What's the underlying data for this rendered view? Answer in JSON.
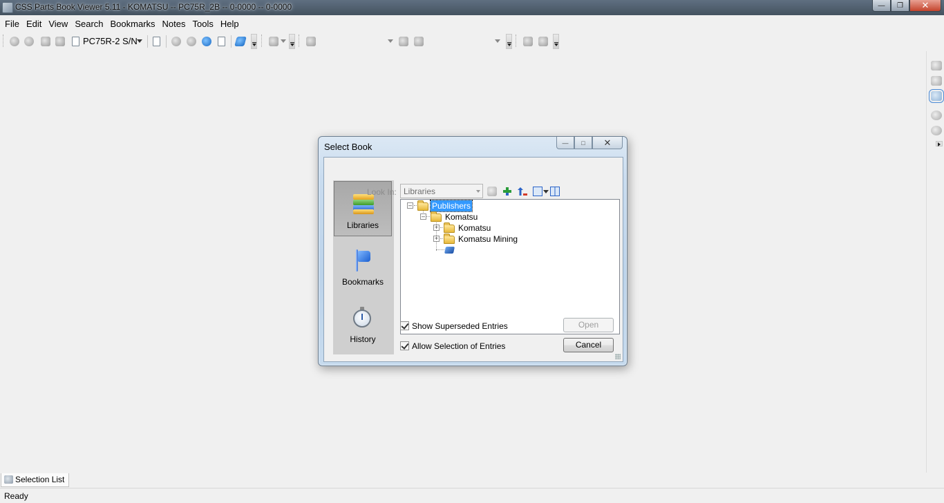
{
  "window": {
    "title": "CSS Parts Book Viewer 5.11 - KOMATSU -- PC75R_2B -- 0-0000 -- 0-0000",
    "controls": [
      "minimize",
      "maximize",
      "close"
    ]
  },
  "menu": {
    "items": [
      {
        "label": "File"
      },
      {
        "label": "Edit"
      },
      {
        "label": "View"
      },
      {
        "label": "Search"
      },
      {
        "label": "Bookmarks"
      },
      {
        "label": "Notes"
      },
      {
        "label": "Tools"
      },
      {
        "label": "Help"
      }
    ]
  },
  "toolbar": {
    "serial_combo": "PC75R-2 S/N"
  },
  "dialog": {
    "title": "Select Book",
    "places": [
      {
        "label": "Libraries",
        "icon": "books-icon",
        "selected": true
      },
      {
        "label": "Bookmarks",
        "icon": "flag-icon",
        "selected": false
      },
      {
        "label": "History",
        "icon": "stopwatch-icon",
        "selected": false
      }
    ],
    "look_in_label": "Look In:",
    "look_in_value": "Libraries",
    "tree": {
      "root": "Publishers",
      "child": "Komatsu",
      "grandchildren": [
        "Komatsu",
        "Komatsu Mining"
      ]
    },
    "options": {
      "show_superseded": {
        "label": "Show Superseded Entries",
        "checked": true
      },
      "allow_selection": {
        "label": "Allow Selection of Entries",
        "checked": true
      }
    },
    "buttons": {
      "open": "Open",
      "cancel": "Cancel"
    }
  },
  "bottom": {
    "tab_label": "Selection List",
    "status": "Ready"
  }
}
